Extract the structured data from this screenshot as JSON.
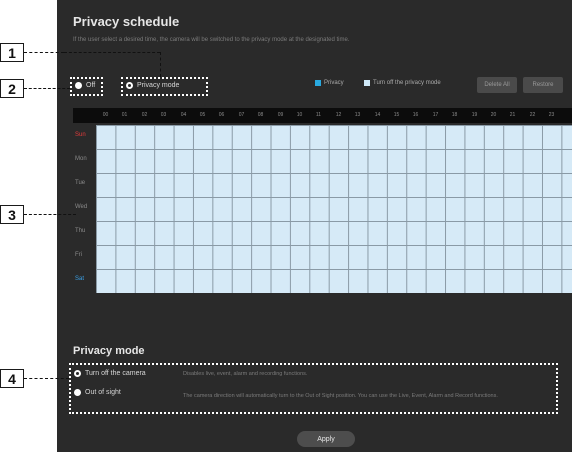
{
  "title": "Privacy schedule",
  "description": "If the user select a desired time, the camera will be switched to the privacy mode at the designated time.",
  "radios": {
    "off": "Off",
    "privacy_mode": "Privacy mode"
  },
  "legend": {
    "privacy": "Privacy",
    "turn_off": "Turn off the privacy mode"
  },
  "legend_colors": {
    "privacy": "#29a9e0",
    "turn_off": "#cfe8f7"
  },
  "buttons": {
    "delete_all": "Delete All",
    "restore": "Restore",
    "apply": "Apply"
  },
  "hours": [
    "00",
    "01",
    "02",
    "03",
    "04",
    "05",
    "06",
    "07",
    "08",
    "09",
    "10",
    "11",
    "12",
    "13",
    "14",
    "15",
    "16",
    "17",
    "18",
    "19",
    "20",
    "21",
    "22",
    "23"
  ],
  "days": [
    "Sun",
    "Mon",
    "Tue",
    "Wed",
    "Thu",
    "Fri",
    "Sat"
  ],
  "privacy_mode": {
    "title": "Privacy mode",
    "options": [
      {
        "label": "Turn off the camera",
        "description": "Disables live, event, alarm and recording functions."
      },
      {
        "label": "Out of sight",
        "description": "The camera direction will automatically turn to the Out of Sight position. You can use the Live, Event, Alarm and Record functions."
      }
    ]
  },
  "callouts": [
    "1",
    "2",
    "3",
    "4"
  ]
}
